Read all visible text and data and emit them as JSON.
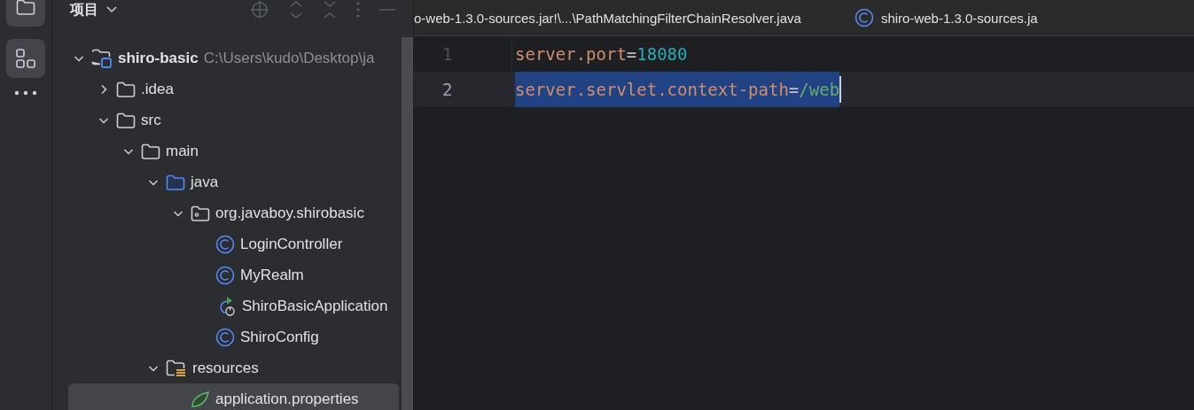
{
  "project_panel": {
    "title": "项目",
    "tree": [
      {
        "label": "shiro-basic",
        "path": "C:\\Users\\kudo\\Desktop\\ja",
        "kind": "module",
        "expanded": true,
        "selected": false,
        "children": [
          {
            "label": ".idea",
            "kind": "folder",
            "expanded": false,
            "selected": false
          },
          {
            "label": "src",
            "kind": "folder",
            "expanded": true,
            "selected": false,
            "children": [
              {
                "label": "main",
                "kind": "folder",
                "expanded": true,
                "selected": false,
                "children": [
                  {
                    "label": "java",
                    "kind": "source",
                    "expanded": true,
                    "selected": false,
                    "children": [
                      {
                        "label": "org.javaboy.shirobasic",
                        "kind": "package",
                        "expanded": true,
                        "selected": false,
                        "children": [
                          {
                            "label": "LoginController",
                            "kind": "class",
                            "selected": false
                          },
                          {
                            "label": "MyRealm",
                            "kind": "class",
                            "selected": false
                          },
                          {
                            "label": "ShiroBasicApplication",
                            "kind": "app",
                            "selected": false
                          },
                          {
                            "label": "ShiroConfig",
                            "kind": "class",
                            "selected": false
                          }
                        ]
                      }
                    ]
                  },
                  {
                    "label": "resources",
                    "kind": "resources",
                    "expanded": true,
                    "selected": false,
                    "children": [
                      {
                        "label": "application.properties",
                        "kind": "properties",
                        "selected": true
                      }
                    ]
                  }
                ]
              }
            ]
          }
        ]
      }
    ]
  },
  "editor": {
    "tabs": [
      {
        "label": "o-web-1.3.0-sources.jar!\\...\\PathMatchingFilterChainResolver.java",
        "kind": "plain"
      },
      {
        "label": "shiro-web-1.3.0-sources.ja",
        "kind": "class"
      }
    ],
    "lines": [
      {
        "number": "1",
        "current": false,
        "tokens": [
          {
            "text": "server.port",
            "kind": "key",
            "selected": false
          },
          {
            "text": "=",
            "kind": "sep",
            "selected": false
          },
          {
            "text": "18080",
            "kind": "number",
            "selected": false
          }
        ]
      },
      {
        "number": "2",
        "current": true,
        "tokens": [
          {
            "text": "server.servlet.context-path",
            "kind": "key",
            "selected": true
          },
          {
            "text": "=",
            "kind": "sep",
            "selected": true
          },
          {
            "text": "/web",
            "kind": "value",
            "selected": true
          }
        ]
      }
    ]
  }
}
